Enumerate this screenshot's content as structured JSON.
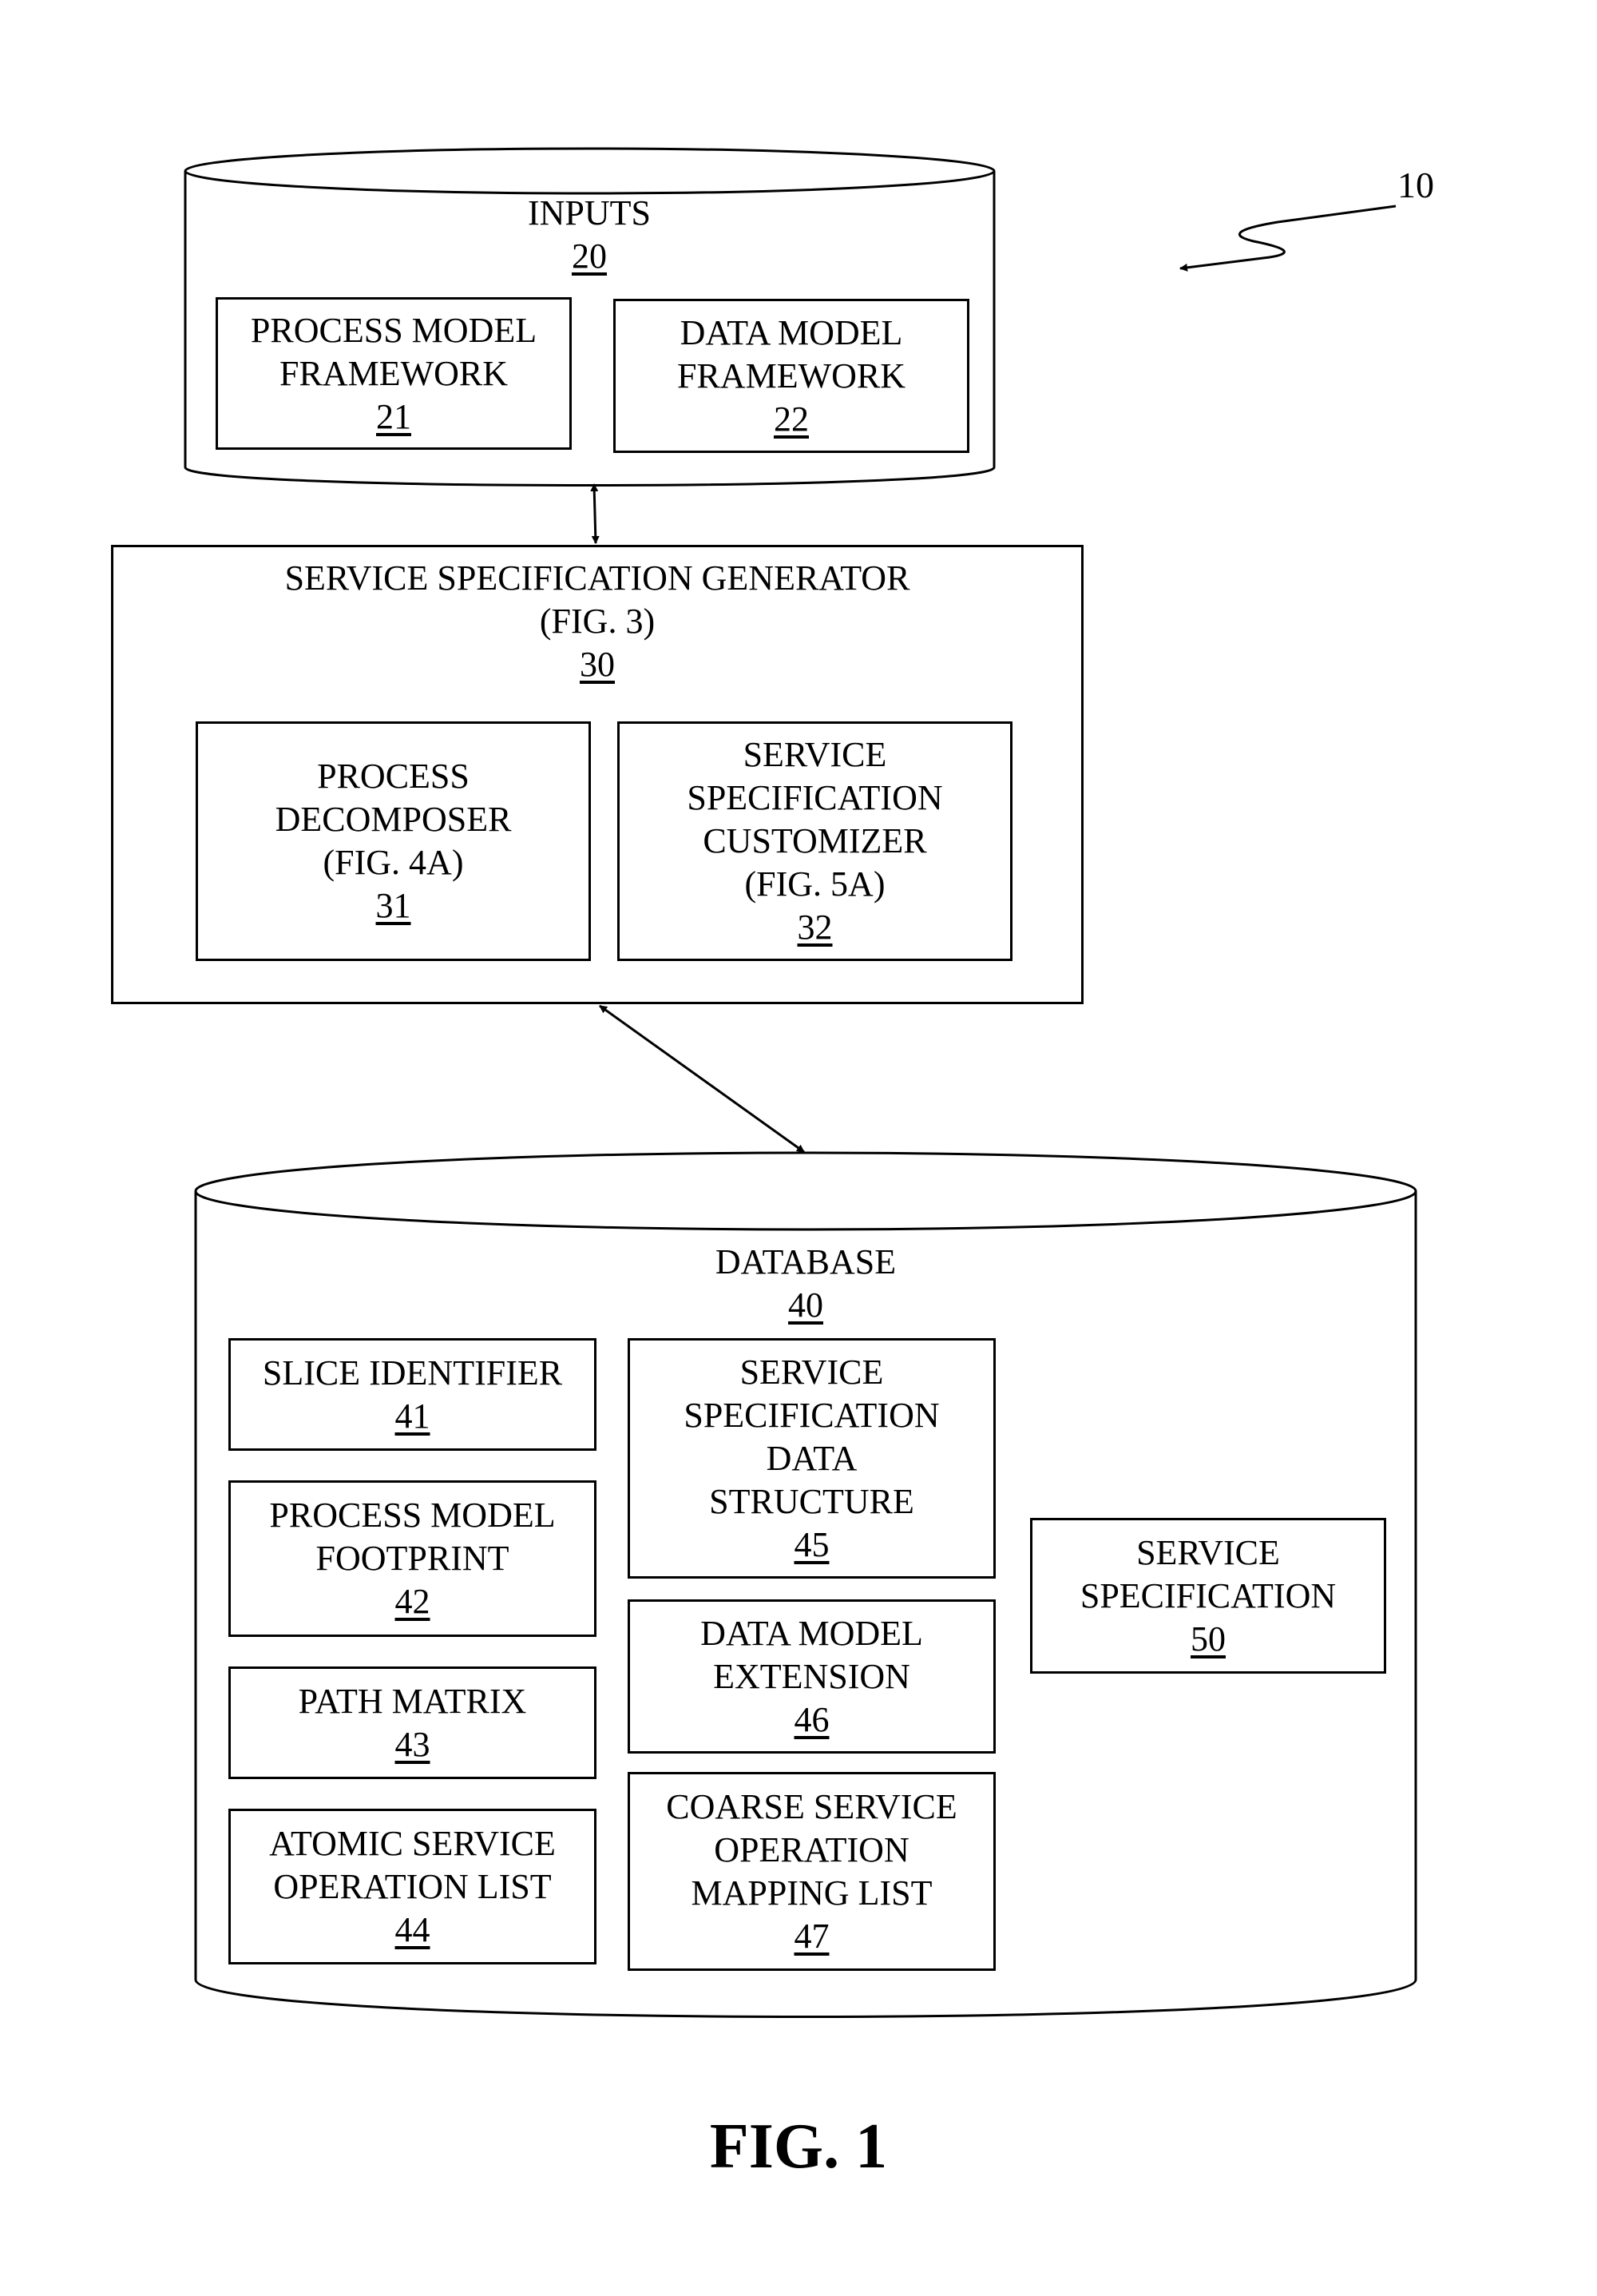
{
  "figure": {
    "caption": "FIG. 1",
    "system_ref": "10"
  },
  "inputs": {
    "title": "INPUTS",
    "ref": "20",
    "children": [
      {
        "lines": [
          "PROCESS MODEL",
          "FRAMEWORK"
        ],
        "ref": "21"
      },
      {
        "lines": [
          "DATA MODEL",
          "FRAMEWORK"
        ],
        "ref": "22"
      }
    ]
  },
  "generator": {
    "lines": [
      "SERVICE SPECIFICATION GENERATOR",
      "(FIG. 3)"
    ],
    "ref": "30",
    "children": [
      {
        "lines": [
          "PROCESS",
          "DECOMPOSER",
          "(FIG. 4A)"
        ],
        "ref": "31"
      },
      {
        "lines": [
          "SERVICE",
          "SPECIFICATION",
          "CUSTOMIZER",
          "(FIG. 5A)"
        ],
        "ref": "32"
      }
    ]
  },
  "database": {
    "title": "DATABASE",
    "ref": "40",
    "children": [
      {
        "lines": [
          "SLICE IDENTIFIER"
        ],
        "ref": "41"
      },
      {
        "lines": [
          "PROCESS MODEL",
          "FOOTPRINT"
        ],
        "ref": "42"
      },
      {
        "lines": [
          "PATH MATRIX"
        ],
        "ref": "43"
      },
      {
        "lines": [
          "ATOMIC SERVICE",
          "OPERATION LIST"
        ],
        "ref": "44"
      },
      {
        "lines": [
          "SERVICE",
          "SPECIFICATION",
          "DATA",
          "STRUCTURE"
        ],
        "ref": "45"
      },
      {
        "lines": [
          "DATA MODEL",
          "EXTENSION"
        ],
        "ref": "46"
      },
      {
        "lines": [
          "COARSE SERVICE",
          "OPERATION",
          "MAPPING LIST"
        ],
        "ref": "47"
      },
      {
        "lines": [
          "SERVICE",
          "SPECIFICATION"
        ],
        "ref": "50"
      }
    ]
  }
}
